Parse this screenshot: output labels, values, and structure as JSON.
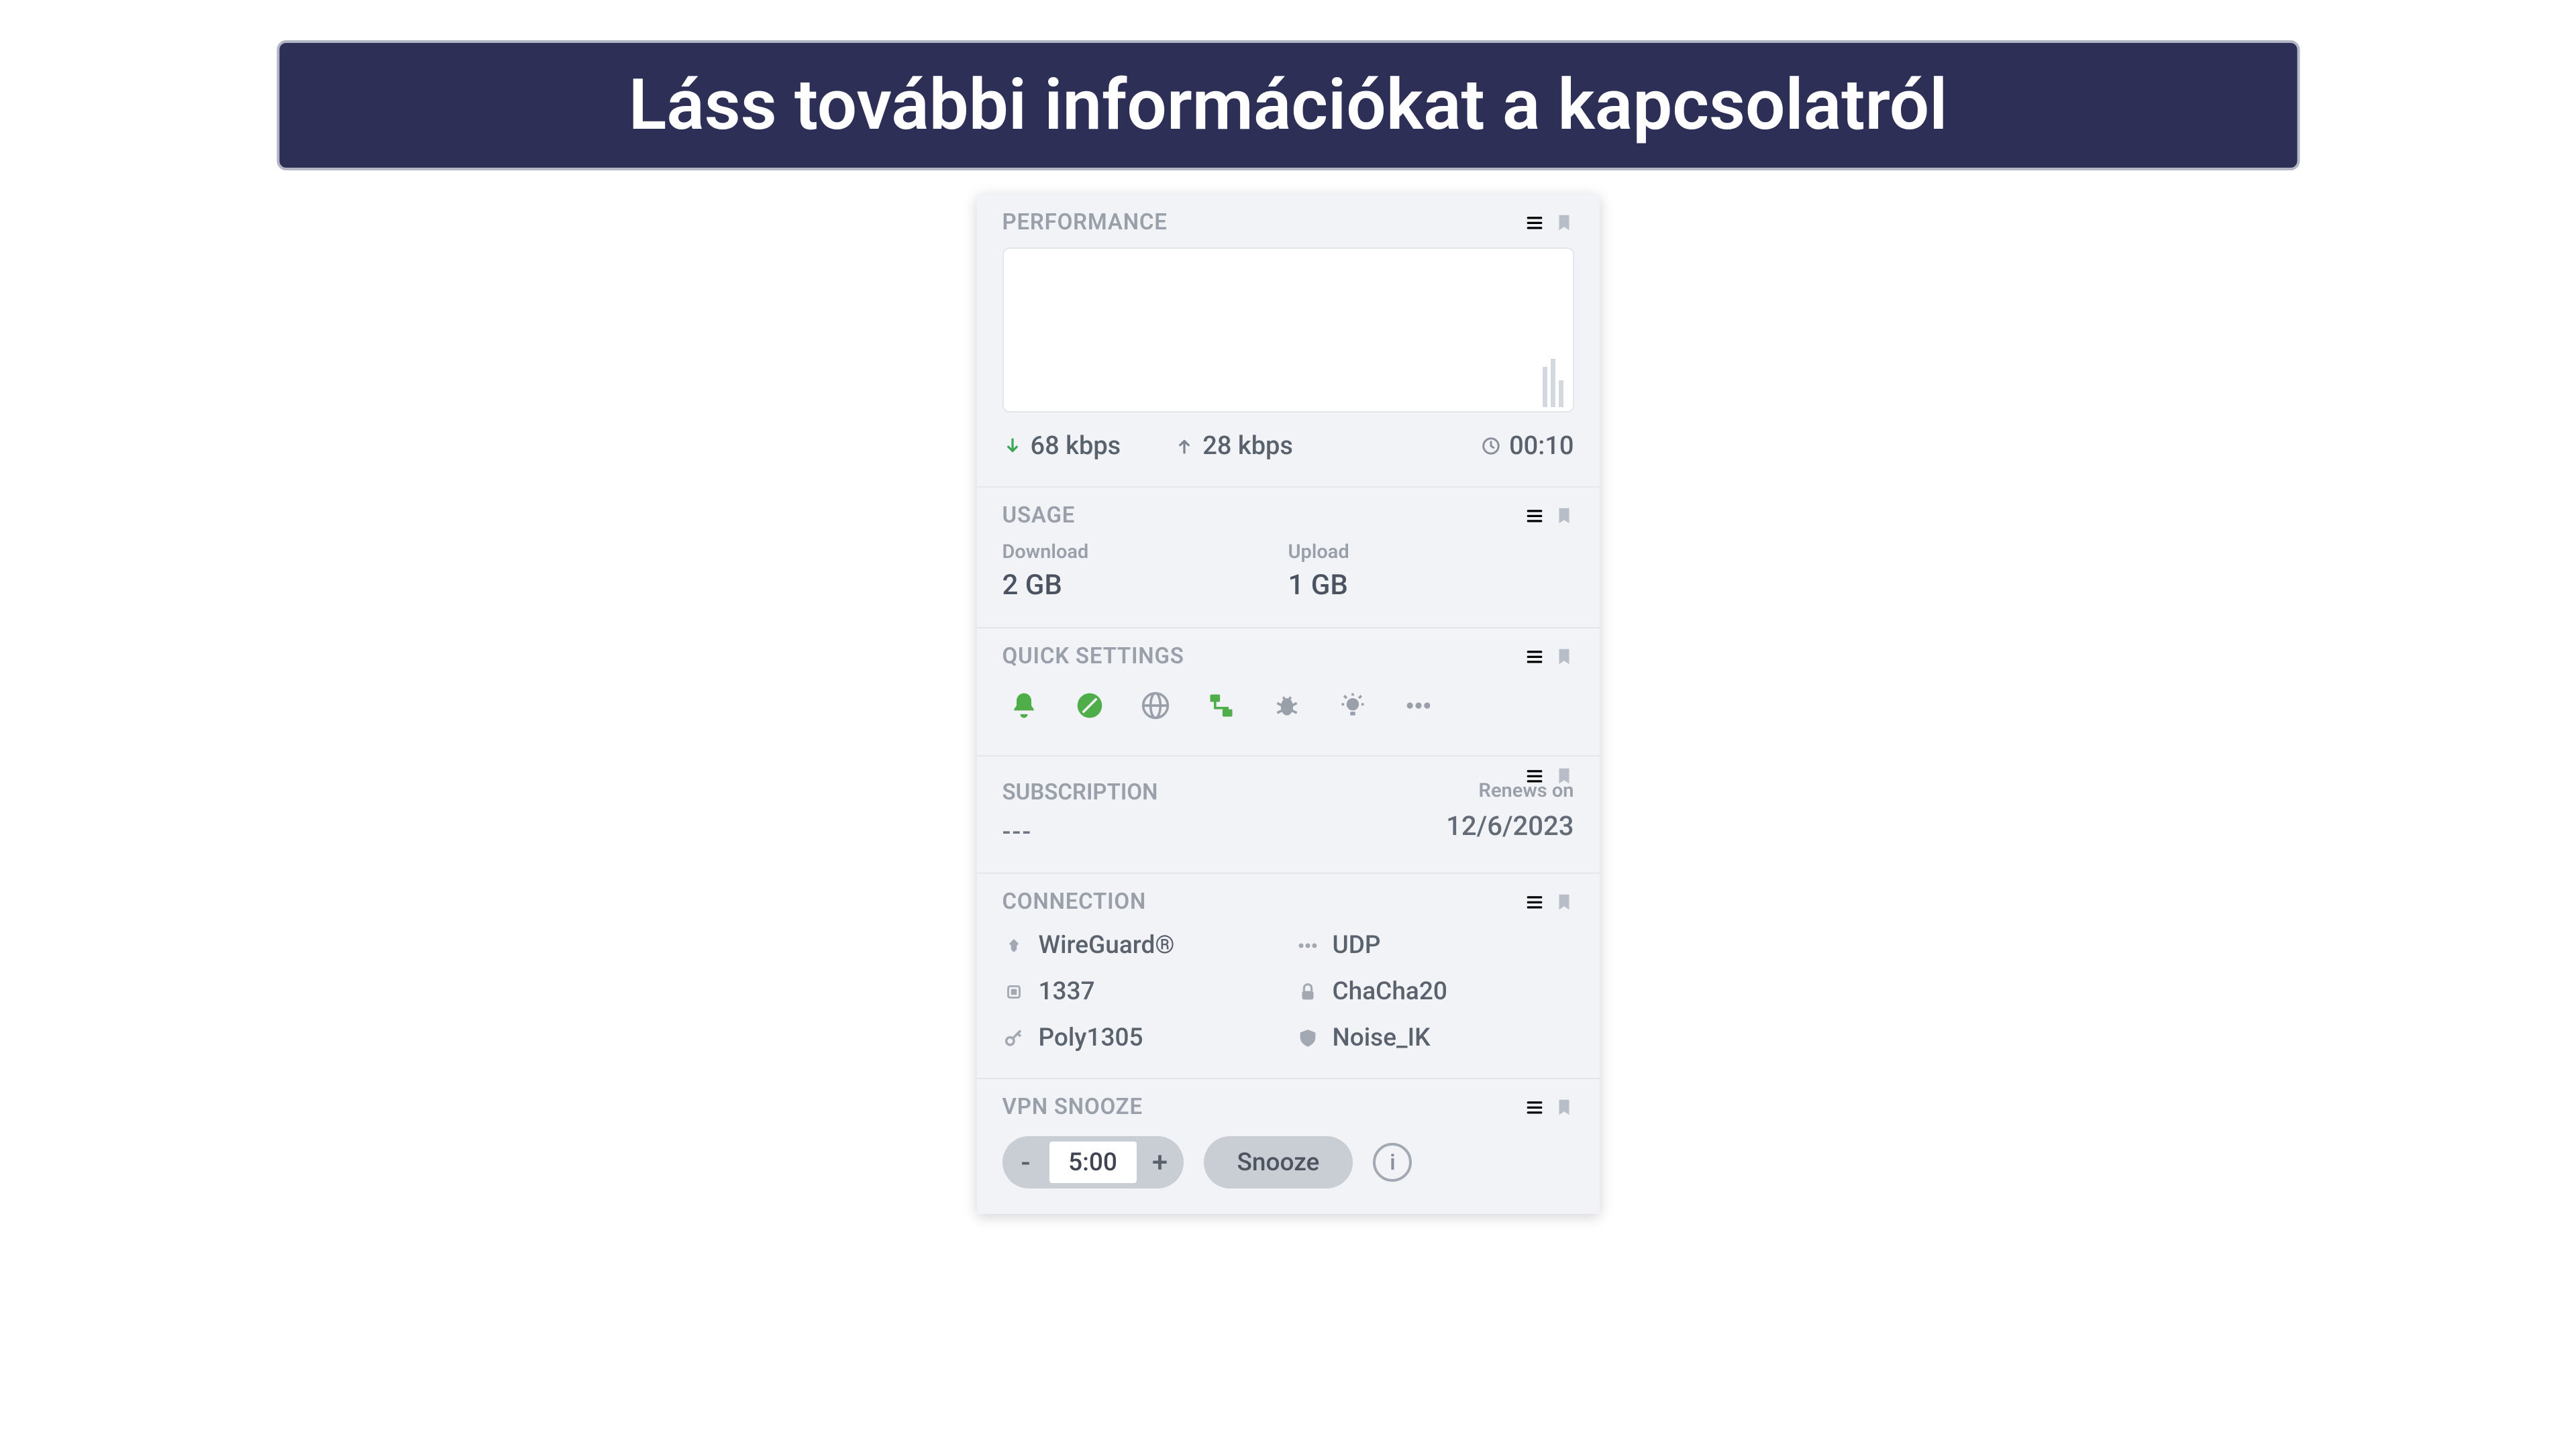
{
  "banner": {
    "text": "Láss további információkat a kapcsolatról"
  },
  "sections": {
    "performance": {
      "title": "PERFORMANCE",
      "download_speed": "68 kbps",
      "upload_speed": "28 kbps",
      "duration": "00:10"
    },
    "usage": {
      "title": "USAGE",
      "download_label": "Download",
      "download_value": "2 GB",
      "upload_label": "Upload",
      "upload_value": "1 GB"
    },
    "quick_settings": {
      "title": "QUICK SETTINGS"
    },
    "subscription": {
      "title": "SUBSCRIPTION",
      "plan_value": "---",
      "renews_label": "Renews on",
      "renews_date": "12/6/2023"
    },
    "connection": {
      "title": "CONNECTION",
      "protocol": "WireGuard®",
      "transport": "UDP",
      "port": "1337",
      "cipher": "ChaCha20",
      "auth": "Poly1305",
      "handshake": "Noise_IK"
    },
    "snooze": {
      "title": "VPN SNOOZE",
      "minus": "-",
      "plus": "+",
      "time": "5:00",
      "button": "Snooze",
      "info": "i"
    }
  }
}
